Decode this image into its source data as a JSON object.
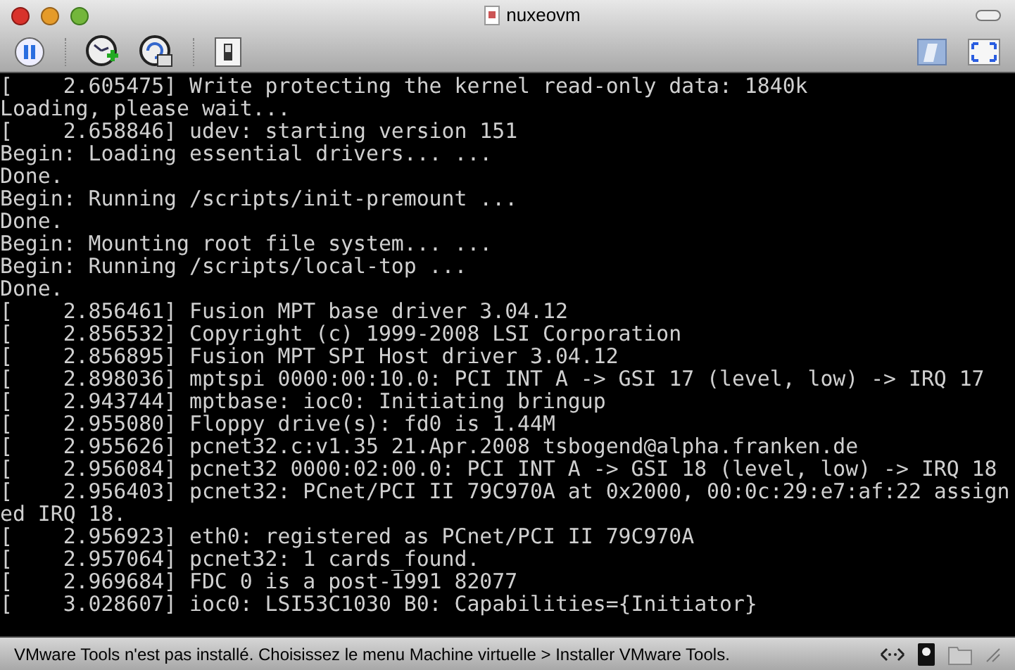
{
  "window": {
    "title": "nuxeovm"
  },
  "console": {
    "lines": [
      "[    2.605475] Write protecting the kernel read-only data: 1840k",
      "Loading, please wait...",
      "[    2.658846] udev: starting version 151",
      "Begin: Loading essential drivers... ...",
      "Done.",
      "Begin: Running /scripts/init-premount ...",
      "Done.",
      "Begin: Mounting root file system... ...",
      "Begin: Running /scripts/local-top ...",
      "Done.",
      "[    2.856461] Fusion MPT base driver 3.04.12",
      "[    2.856532] Copyright (c) 1999-2008 LSI Corporation",
      "[    2.856895] Fusion MPT SPI Host driver 3.04.12",
      "[    2.898036] mptspi 0000:00:10.0: PCI INT A -> GSI 17 (level, low) -> IRQ 17",
      "[    2.943744] mptbase: ioc0: Initiating bringup",
      "[    2.955080] Floppy drive(s): fd0 is 1.44M",
      "[    2.955626] pcnet32.c:v1.35 21.Apr.2008 tsbogend@alpha.franken.de",
      "[    2.956084] pcnet32 0000:02:00.0: PCI INT A -> GSI 18 (level, low) -> IRQ 18",
      "[    2.956403] pcnet32: PCnet/PCI II 79C970A at 0x2000, 00:0c:29:e7:af:22 assign",
      "ed IRQ 18.",
      "[    2.956923] eth0: registered as PCnet/PCI II 79C970A",
      "[    2.957064] pcnet32: 1 cards_found.",
      "[    2.969684] FDC 0 is a post-1991 82077",
      "[    3.028607] ioc0: LSI53C1030 B0: Capabilities={Initiator}"
    ]
  },
  "status_bar": {
    "message": "VMware Tools n'est pas installé. Choisissez le menu Machine virtuelle > Installer VMware Tools."
  }
}
